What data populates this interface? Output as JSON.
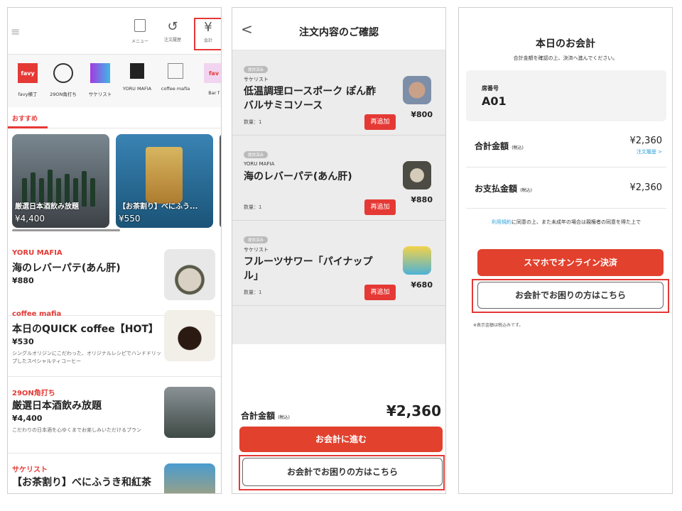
{
  "screen1": {
    "header": {
      "menu_label": "メニュー",
      "history_label": "注文履歴",
      "pay_label": "会計",
      "pay_icon": "¥"
    },
    "shops": [
      {
        "name": "favy横丁",
        "logo": "favy"
      },
      {
        "name": "29ON角打ち",
        "logo": ""
      },
      {
        "name": "サケリスト",
        "logo": ""
      },
      {
        "name": "YORU MAFIA",
        "logo": ""
      },
      {
        "name": "coffee mafia",
        "logo": ""
      },
      {
        "name": "Bar f",
        "logo": "fav"
      }
    ],
    "tab_recommended": "おすすめ",
    "cards": [
      {
        "name": "厳選日本酒飲み放題",
        "price": "¥4,400"
      },
      {
        "name": "【お茶割り】べにふう...",
        "price": "¥550"
      }
    ],
    "items": [
      {
        "shop": "YORU MAFIA",
        "title": "海のレバーパテ(あん肝)",
        "price": "¥880",
        "desc": ""
      },
      {
        "shop": "coffee mafia",
        "title": "本日のQUICK coffee【HOT】",
        "price": "¥530",
        "desc": "シングルオリジンにこだわった、オリジナルレシピでハンドドリップしたスペシャルティコーヒー"
      },
      {
        "shop": "29ON角打ち",
        "title": "厳選日本酒飲み放題",
        "price": "¥4,400",
        "desc": "こだわりの日本酒を心ゆくまでお楽しみいただけるプラン"
      },
      {
        "shop": "サケリスト",
        "title": "【お茶割り】べにふうき和紅茶",
        "price": "",
        "desc": ""
      }
    ]
  },
  "screen2": {
    "title": "注文内容のご確認",
    "orders": [
      {
        "badge": "提供済み",
        "shop": "サケリスト",
        "name": "低温調理ロースポーク ぽん酢バルサミコソース",
        "qty": "数量：1",
        "readd": "再追加",
        "price": "¥800"
      },
      {
        "badge": "提供済み",
        "shop": "YORU MAFIA",
        "name": "海のレバーパテ(あん肝)",
        "qty": "数量：1",
        "readd": "再追加",
        "price": "¥880"
      },
      {
        "badge": "提供済み",
        "shop": "サケリスト",
        "name": "フルーツサワー「パイナップル」",
        "qty": "数量：1",
        "readd": "再追加",
        "price": "¥680"
      }
    ],
    "total_label": "合計金額",
    "tax_label": "(税込)",
    "total_value": "¥2,360",
    "proceed_button": "お会計に進む",
    "help_button": "お会計でお困りの方はこちら"
  },
  "screen3": {
    "title": "本日のお会計",
    "subtitle": "合計金額を確認の上、決済へ進んでください。",
    "seat_label": "席番号",
    "seat_value": "A01",
    "total_label": "合計金額",
    "tax_label": "(税込)",
    "total_value": "¥2,360",
    "history_link": "注文履歴 >",
    "pay_label": "お支払金額",
    "pay_value": "¥2,360",
    "terms_link": "利用規約",
    "terms_text": "に同意の上、また未成年の場合は親権者の同意を得た上で",
    "online_button": "スマホでオンライン決済",
    "help_button": "お会計でお困りの方はこちら",
    "note": "※表示金額は税込みです。"
  },
  "colors": {
    "accent": "#e2412d",
    "highlight": "#e53935",
    "link": "#2aa0d9"
  }
}
